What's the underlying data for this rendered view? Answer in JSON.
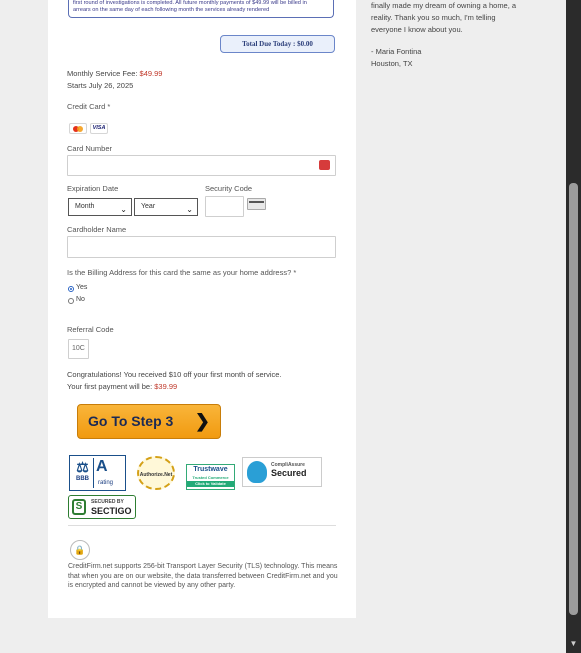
{
  "notice": {
    "line1": "first round of investigations is completed. All future monthly payments of $49.99 will be billed in",
    "line2": "arrears on the same day of each following month the services already rendered"
  },
  "total_due": "Total Due Today : $0.00",
  "monthly_fee_label": "Monthly Service Fee: ",
  "monthly_fee_value": "$49.99",
  "starts": "Starts July 26, 2025",
  "credit_card_label": "Credit Card *",
  "visa_label": "VISA",
  "card_number_label": "Card Number",
  "expiration_label": "Expiration Date",
  "month_select": "Month",
  "year_select": "Year",
  "security_code_label": "Security Code",
  "cardholder_label": "Cardholder Name",
  "billing_question": "Is the Billing Address for this card the same as your home address? *",
  "billing_options": [
    "Yes",
    "No"
  ],
  "billing_selected": "Yes",
  "referral_label": "Referral Code",
  "referral_value": "10C",
  "congrats": "Congratulations! You received $10 off your first month of service.",
  "first_payment_label": "Your first payment will be: ",
  "first_payment_value": "$39.99",
  "step_button": "Go To Step 3",
  "badges": {
    "bbb": "BBB",
    "bbb_rating": "A",
    "bbb_sub": "rating",
    "authorize": "Authorize.Net",
    "trustwave": "Trustwave",
    "trustwave_sub": "Trusted Commerce",
    "trustwave_click": "Click to Validate",
    "compliassure": "CompliAssure",
    "secured": "Secured",
    "sectigo_top": "SECURED BY",
    "sectigo": "SECTIGO"
  },
  "tls_text": "CreditFirm.net supports 256-bit Transport Layer Security (TLS) technology. This means that when you are on our website, the data transferred between CreditFirm.net and you is encrypted and cannot be viewed by any other party.",
  "testimonial": {
    "line1": "finally made my dream of owning a home, a",
    "line2": "reality. Thank you so much, I'm telling",
    "line3": "everyone I know about you.",
    "author": "- Maria Fontina",
    "location": "Houston, TX"
  },
  "colors": {
    "price": "#c0392b",
    "button": "#f19a10",
    "accent": "#2c3f7a"
  }
}
